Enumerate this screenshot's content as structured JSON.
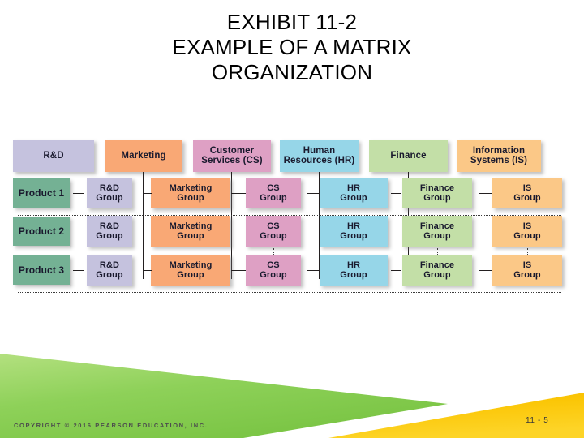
{
  "slide": {
    "title_lines": [
      "EXHIBIT 11-2",
      "EXAMPLE OF A MATRIX",
      "ORGANIZATION"
    ],
    "copyright": "COPYRIGHT © 2016 PEARSON EDUCATION, INC.",
    "slide_number": "11 - 5"
  },
  "colors": {
    "rnd": "#c5c2de",
    "marketing": "#f9a875",
    "customer_services": "#dea0c4",
    "human_resources": "#96d6e8",
    "finance": "#c3dfa7",
    "information_systems": "#fbc887",
    "product": "#74b194",
    "band_green": "#8ed15a",
    "band_yellow": "#fbc402",
    "connector": "#231f20"
  },
  "matrix": {
    "function_headers": [
      {
        "key": "rnd",
        "label": "R&D"
      },
      {
        "key": "marketing",
        "label": "Marketing"
      },
      {
        "key": "cs",
        "label_line1": "Customer",
        "label_line2": "Services (CS)"
      },
      {
        "key": "hr",
        "label_line1": "Human",
        "label_line2": "Resources (HR)"
      },
      {
        "key": "finance",
        "label": "Finance"
      },
      {
        "key": "is",
        "label_line1": "Information",
        "label_line2": "Systems (IS)"
      }
    ],
    "product_rows": [
      {
        "product": "Product 1",
        "groups": [
          {
            "line1": "R&D",
            "line2": "Group"
          },
          {
            "line1": "Marketing",
            "line2": "Group"
          },
          {
            "line1": "CS",
            "line2": "Group"
          },
          {
            "line1": "HR",
            "line2": "Group"
          },
          {
            "line1": "Finance",
            "line2": "Group"
          },
          {
            "line1": "IS",
            "line2": "Group"
          }
        ]
      },
      {
        "product": "Product 2",
        "groups": [
          {
            "line1": "R&D",
            "line2": "Group"
          },
          {
            "line1": "Marketing",
            "line2": "Group"
          },
          {
            "line1": "CS",
            "line2": "Group"
          },
          {
            "line1": "HR",
            "line2": "Group"
          },
          {
            "line1": "Finance",
            "line2": "Group"
          },
          {
            "line1": "IS",
            "line2": "Group"
          }
        ]
      },
      {
        "product": "Product 3",
        "groups": [
          {
            "line1": "R&D",
            "line2": "Group"
          },
          {
            "line1": "Marketing",
            "line2": "Group"
          },
          {
            "line1": "CS",
            "line2": "Group"
          },
          {
            "line1": "HR",
            "line2": "Group"
          },
          {
            "line1": "Finance",
            "line2": "Group"
          },
          {
            "line1": "IS",
            "line2": "Group"
          }
        ]
      }
    ]
  }
}
